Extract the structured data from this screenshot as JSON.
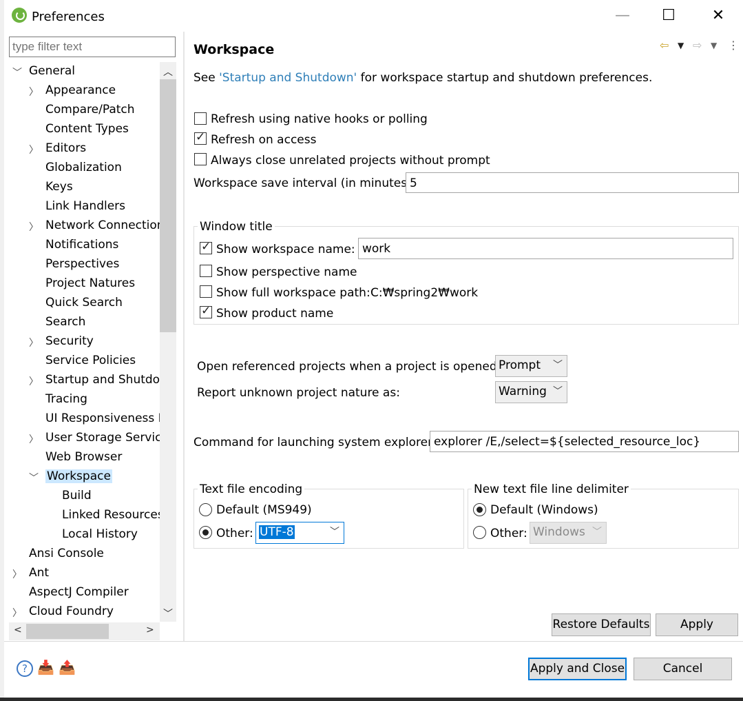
{
  "window": {
    "title": "Preferences",
    "minimize": "—",
    "maximize": "☐",
    "close": "✕"
  },
  "filter": {
    "placeholder": "type filter text"
  },
  "tree": [
    {
      "label": "General",
      "depth": 0,
      "twisty": "open"
    },
    {
      "label": "Appearance",
      "depth": 1,
      "twisty": "closed"
    },
    {
      "label": "Compare/Patch",
      "depth": 1,
      "twisty": ""
    },
    {
      "label": "Content Types",
      "depth": 1,
      "twisty": ""
    },
    {
      "label": "Editors",
      "depth": 1,
      "twisty": "closed"
    },
    {
      "label": "Globalization",
      "depth": 1,
      "twisty": ""
    },
    {
      "label": "Keys",
      "depth": 1,
      "twisty": ""
    },
    {
      "label": "Link Handlers",
      "depth": 1,
      "twisty": ""
    },
    {
      "label": "Network Connection",
      "depth": 1,
      "twisty": "closed"
    },
    {
      "label": "Notifications",
      "depth": 1,
      "twisty": ""
    },
    {
      "label": "Perspectives",
      "depth": 1,
      "twisty": ""
    },
    {
      "label": "Project Natures",
      "depth": 1,
      "twisty": ""
    },
    {
      "label": "Quick Search",
      "depth": 1,
      "twisty": ""
    },
    {
      "label": "Search",
      "depth": 1,
      "twisty": ""
    },
    {
      "label": "Security",
      "depth": 1,
      "twisty": "closed"
    },
    {
      "label": "Service Policies",
      "depth": 1,
      "twisty": ""
    },
    {
      "label": "Startup and Shutdov",
      "depth": 1,
      "twisty": "closed"
    },
    {
      "label": "Tracing",
      "depth": 1,
      "twisty": ""
    },
    {
      "label": "UI Responsiveness M",
      "depth": 1,
      "twisty": ""
    },
    {
      "label": "User Storage Service",
      "depth": 1,
      "twisty": "closed"
    },
    {
      "label": "Web Browser",
      "depth": 1,
      "twisty": ""
    },
    {
      "label": "Workspace",
      "depth": 1,
      "twisty": "open",
      "selected": true
    },
    {
      "label": "Build",
      "depth": 2,
      "twisty": ""
    },
    {
      "label": "Linked Resources",
      "depth": 2,
      "twisty": ""
    },
    {
      "label": "Local History",
      "depth": 2,
      "twisty": ""
    },
    {
      "label": "Ansi Console",
      "depth": 0,
      "twisty": ""
    },
    {
      "label": "Ant",
      "depth": 0,
      "twisty": "closed"
    },
    {
      "label": "AspectJ Compiler",
      "depth": 0,
      "twisty": ""
    },
    {
      "label": "Cloud Foundry",
      "depth": 0,
      "twisty": "closed"
    }
  ],
  "page": {
    "title": "Workspace",
    "intro_before": "See ",
    "intro_link": "'Startup and Shutdown'",
    "intro_after": " for workspace startup and shutdown preferences.",
    "refresh_native": "Refresh using native hooks or polling",
    "refresh_access": "Refresh on access",
    "close_unrelated": "Always close unrelated projects without prompt",
    "save_interval_label": "Workspace save interval (in minutes):",
    "save_interval_value": "5",
    "window_title_group": "Window title",
    "show_ws_name": "Show workspace name:",
    "ws_name_value": "work",
    "show_perspective": "Show perspective name",
    "show_full_path": "Show full workspace path:",
    "full_path_value": "C:₩spring2₩work",
    "show_product": "Show product name",
    "open_ref_label": "Open referenced projects when a project is opened:",
    "open_ref_value": "Prompt",
    "report_nature_label": "Report unknown project nature as:",
    "report_nature_value": "Warning",
    "explorer_label": "Command for launching system explorer:",
    "explorer_value": "explorer /E,/select=${selected_resource_loc}",
    "encoding_group": "Text file encoding",
    "encoding_default": "Default (MS949)",
    "encoding_other": "Other:",
    "encoding_value": "UTF-8",
    "delimiter_group": "New text file line delimiter",
    "delimiter_default": "Default (Windows)",
    "delimiter_other": "Other:",
    "delimiter_value": "Windows",
    "restore_defaults": "Restore Defaults",
    "apply": "Apply"
  },
  "footer": {
    "apply_close": "Apply and Close",
    "cancel": "Cancel"
  },
  "colors": {
    "link": "#2f7fb8",
    "selection": "#cce8ff",
    "accent": "#0078d7"
  }
}
